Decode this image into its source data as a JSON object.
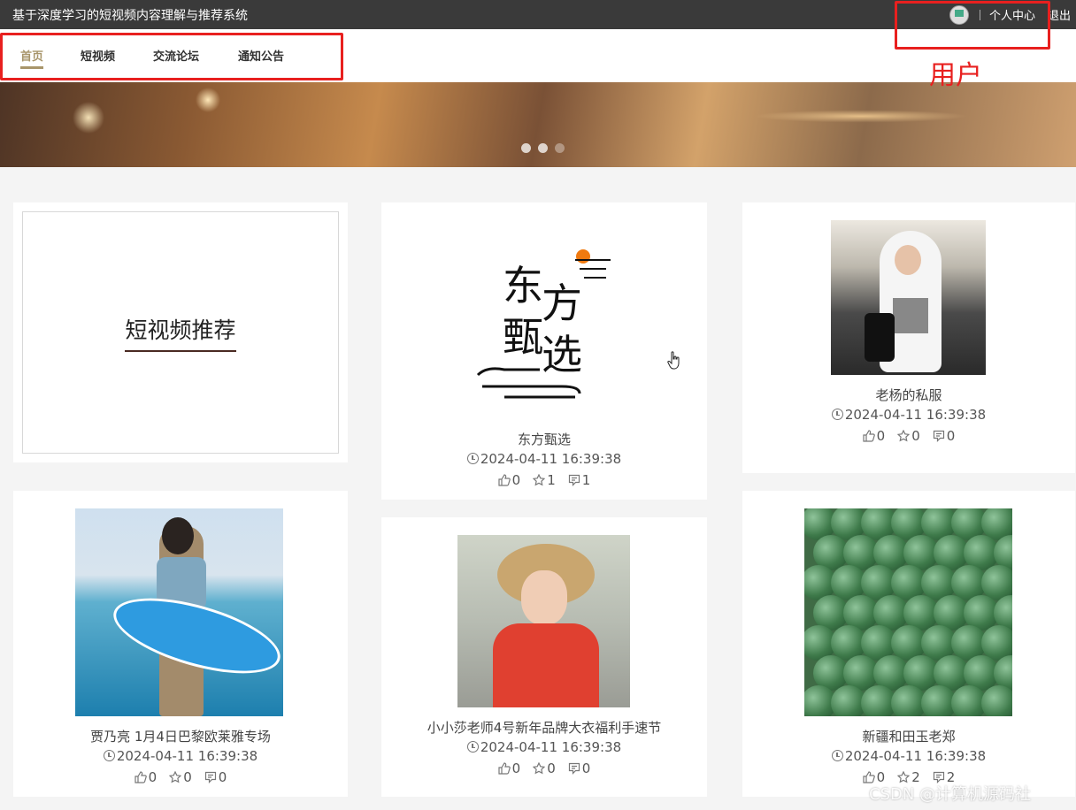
{
  "header": {
    "site_title": "基于深度学习的短视频内容理解与推荐系统",
    "user_center_label": "个人中心",
    "logout_label": "退出"
  },
  "nav": {
    "items": [
      {
        "label": "首页",
        "active": true
      },
      {
        "label": "短视频",
        "active": false
      },
      {
        "label": "交流论坛",
        "active": false
      },
      {
        "label": "通知公告",
        "active": false
      }
    ]
  },
  "annotation": {
    "user_label": "用户"
  },
  "banner": {
    "slide_count": 3
  },
  "recommend": {
    "title": "短视频推荐"
  },
  "videos": [
    {
      "title": "东方甄选",
      "time": "2024-04-11 16:39:38",
      "likes": "0",
      "favorites": "1",
      "comments": "1",
      "thumb": "dongfang-logo"
    },
    {
      "title": "老杨的私服",
      "time": "2024-04-11 16:39:38",
      "likes": "0",
      "favorites": "0",
      "comments": "0",
      "thumb": "woman-hoodie"
    },
    {
      "title": "贾乃亮 1月4日巴黎欧莱雅专场",
      "time": "2024-04-11 16:39:38",
      "likes": "0",
      "favorites": "0",
      "comments": "0",
      "thumb": "man-surfboard"
    },
    {
      "title": "小小莎老师4号新年品牌大衣福利手速节",
      "time": "2024-04-11 16:39:38",
      "likes": "0",
      "favorites": "0",
      "comments": "0",
      "thumb": "woman-hat"
    },
    {
      "title": "新疆和田玉老郑",
      "time": "2024-04-11 16:39:38",
      "likes": "0",
      "favorites": "2",
      "comments": "2",
      "thumb": "jade-pile"
    }
  ],
  "logo_text": {
    "dongfang": "东方甄选"
  },
  "watermark": "CSDN @计算机源码社",
  "colors": {
    "topbar": "#3a3a3a",
    "accent": "#a8956a",
    "annotation": "#e8201f"
  }
}
